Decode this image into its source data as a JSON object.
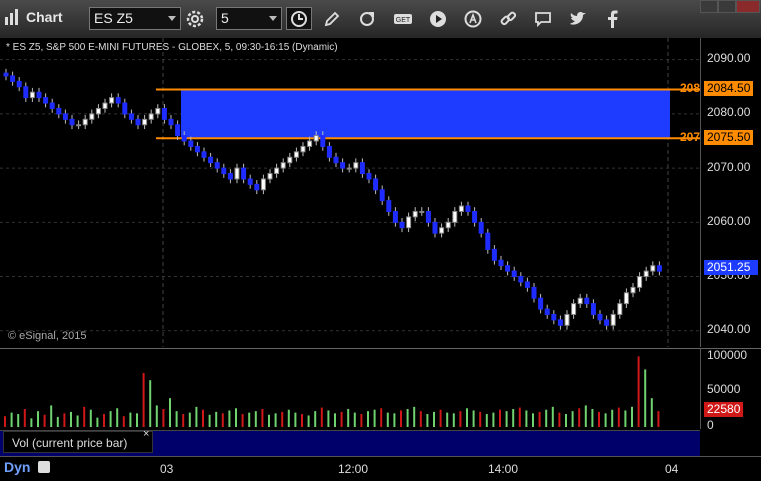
{
  "window": {
    "title": "Chart"
  },
  "toolbar": {
    "symbol": "ES Z5",
    "interval": "5",
    "icons": [
      "settings-gear-icon",
      "clock-icon",
      "pencil-icon",
      "refresh-icon",
      "get-icon",
      "play-icon",
      "a-circle-icon",
      "link-icon",
      "comment-icon",
      "twitter-icon",
      "facebook-icon"
    ]
  },
  "chart": {
    "header": "* ES Z5, S&P 500 E-MINI FUTURES - GLOBEX, 5, 09:30-16:15 (Dynamic)",
    "watermark": "© eSignal, 2015",
    "price_axis": [
      "2090.00",
      "2080.00",
      "2070.00",
      "2060.00",
      "2050.00",
      "2040.00"
    ],
    "zone": {
      "upper": "2084.50",
      "lower": "2075.50",
      "upper_short": "208",
      "lower_short": "207",
      "fill_color": "#1e3cff",
      "line_color": "#ff8c00"
    },
    "last_price": "2051.25",
    "time_axis": [
      "03",
      "12:00",
      "14:00",
      "04"
    ]
  },
  "volume": {
    "axis": [
      "100000",
      "50000",
      "0"
    ],
    "last_volume": "22580",
    "study_label": "Vol (current price bar)",
    "close_label": "×"
  },
  "footer": {
    "mode": "Dyn"
  },
  "chart_data": {
    "type": "candlestick",
    "ylim": [
      2037,
      2094
    ],
    "candles_close": [
      2087,
      2086,
      2085,
      2083,
      2084,
      2083,
      2082,
      2081,
      2080,
      2079,
      2078,
      2078,
      2079,
      2080,
      2081,
      2082,
      2083,
      2082,
      2080,
      2079,
      2078,
      2079,
      2080,
      2081,
      2079,
      2078,
      2076,
      2075,
      2074,
      2073,
      2072,
      2071,
      2070,
      2069,
      2068,
      2070,
      2068,
      2067,
      2066,
      2068,
      2069,
      2070,
      2071,
      2072,
      2073,
      2074,
      2075,
      2076,
      2074,
      2072,
      2071,
      2070,
      2070,
      2071,
      2069,
      2068,
      2066,
      2064,
      2062,
      2060,
      2059,
      2061,
      2062,
      2062,
      2060,
      2058,
      2059,
      2060,
      2062,
      2063,
      2062,
      2060,
      2058,
      2055,
      2053,
      2052,
      2051,
      2050,
      2049,
      2048,
      2046,
      2044,
      2043,
      2042,
      2041,
      2043,
      2045,
      2046,
      2045,
      2043,
      2042,
      2041,
      2043,
      2045,
      2047,
      2048,
      2050,
      2051,
      2052,
      2051
    ],
    "volume_values": [
      15,
      20,
      18,
      25,
      12,
      22,
      17,
      30,
      14,
      19,
      21,
      16,
      28,
      24,
      13,
      18,
      22,
      26,
      15,
      20,
      19,
      75,
      65,
      30,
      25,
      40,
      22,
      18,
      20,
      28,
      24,
      17,
      21,
      19,
      23,
      26,
      18,
      20,
      22,
      25,
      17,
      19,
      21,
      24,
      20,
      18,
      16,
      22,
      27,
      23,
      19,
      21,
      25,
      20,
      18,
      22,
      24,
      26,
      20,
      19,
      23,
      25,
      28,
      22,
      18,
      21,
      24,
      20,
      19,
      22,
      26,
      23,
      21,
      18,
      20,
      24,
      22,
      25,
      27,
      23,
      19,
      21,
      24,
      28,
      20,
      18,
      22,
      26,
      30,
      25,
      21,
      19,
      24,
      27,
      23,
      28,
      98,
      80,
      40,
      22
    ]
  }
}
